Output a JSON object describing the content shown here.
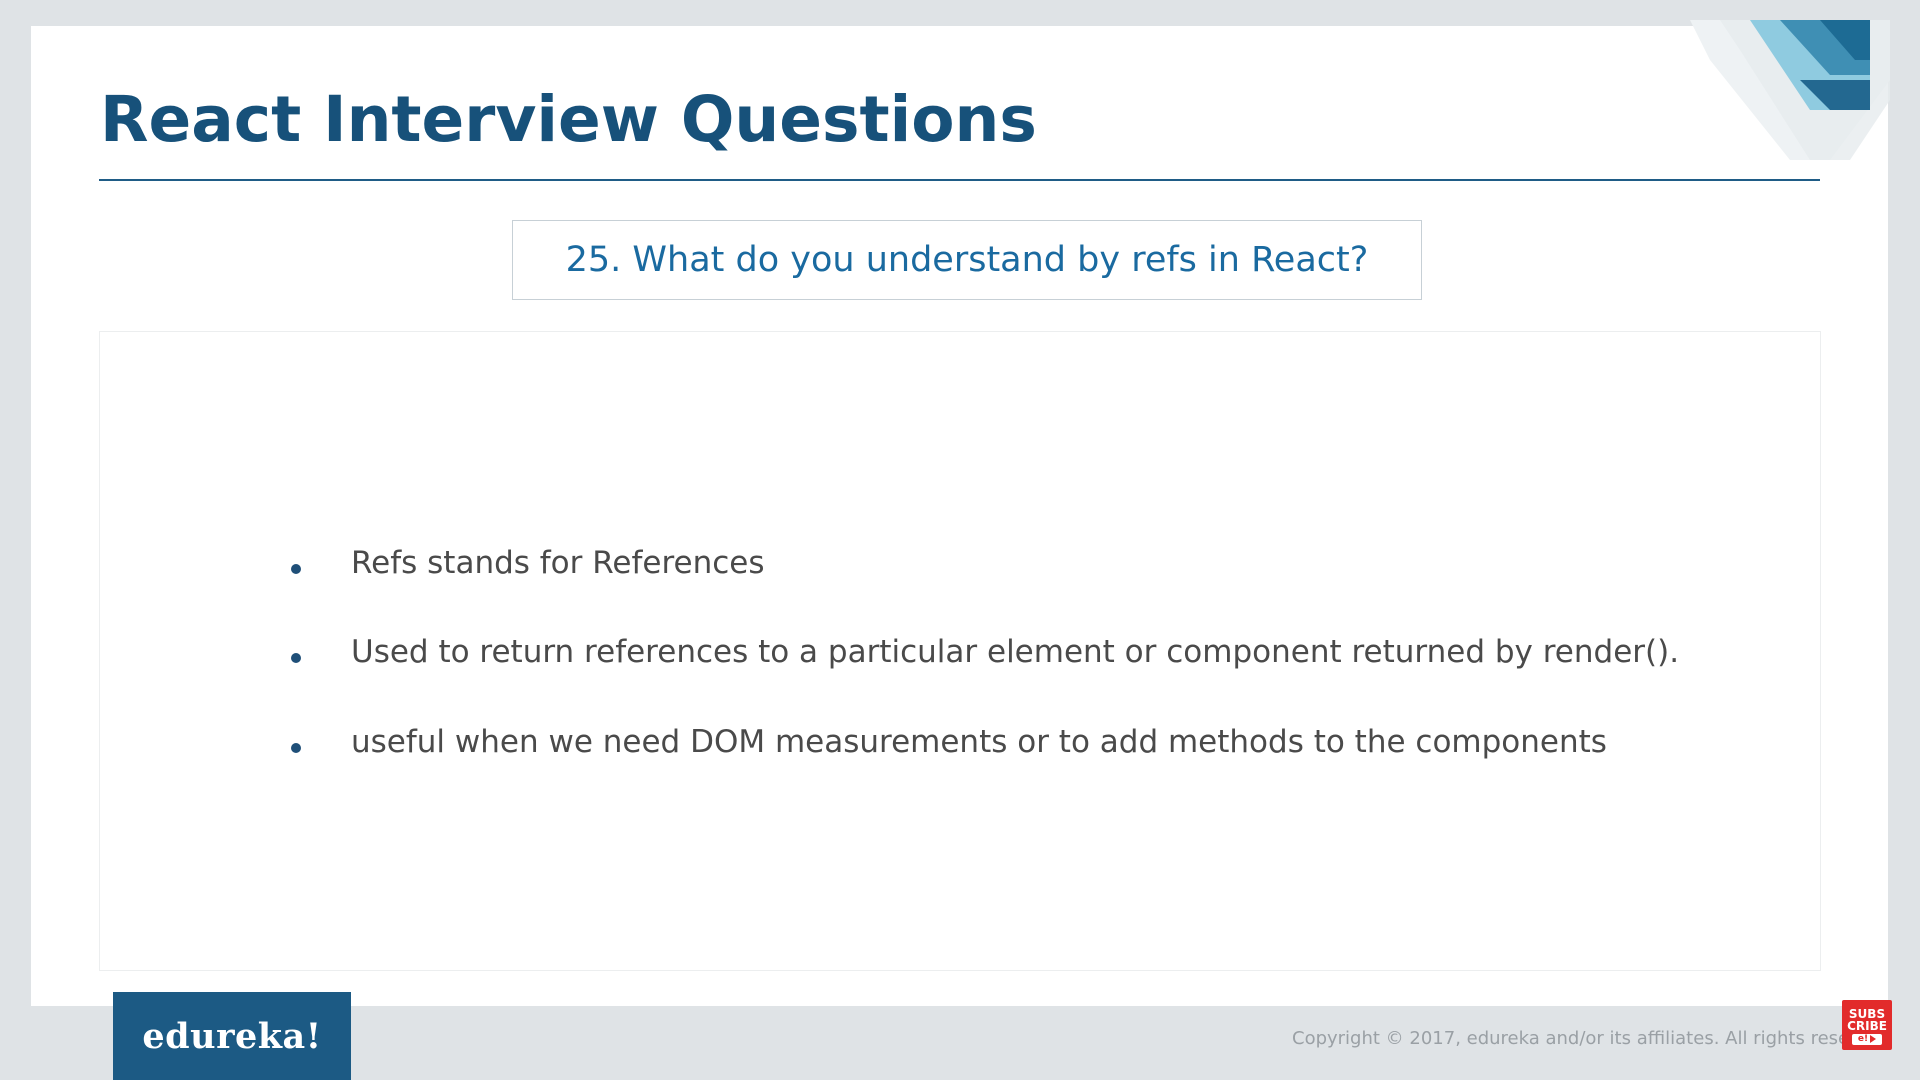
{
  "slide": {
    "title": "React Interview Questions",
    "question": "25. What do you understand by refs in React?",
    "bullets": [
      "Refs stands for References",
      "Used to return references to a particular element or component returned by render().",
      "useful when we need DOM measurements or to add methods to the components"
    ]
  },
  "footer": {
    "logo_text": "edureka!",
    "copyright": "Copyright © 2017, edureka and/or its affiliates. All rights reserved.",
    "subscribe_line1": "SUBS",
    "subscribe_line2": "CRIBE",
    "subscribe_badge": "e!"
  },
  "colors": {
    "title": "#17517a",
    "question": "#1a6aa0",
    "bullet_dot": "#1f4f78",
    "logo_bg": "#1c5a84",
    "subscribe_bg": "#e22b2b"
  },
  "icons": {
    "corner_decoration": "diagonal-stripes",
    "bullet": "bullet-dot-icon",
    "subscribe": "subscribe-badge-icon"
  }
}
